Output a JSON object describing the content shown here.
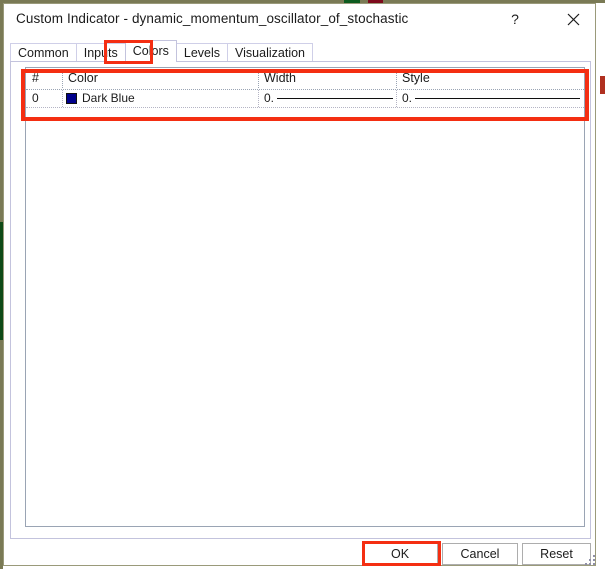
{
  "window": {
    "title": "Custom Indicator - dynamic_momentum_oscillator_of_stochastic",
    "help_label": "?",
    "close_label": "×"
  },
  "tabs": [
    {
      "label": "Common",
      "active": false
    },
    {
      "label": "Inputs",
      "active": false
    },
    {
      "label": "Colors",
      "active": true
    },
    {
      "label": "Levels",
      "active": false
    },
    {
      "label": "Visualization",
      "active": false
    }
  ],
  "colors_tab": {
    "columns": [
      "#",
      "Color",
      "Width",
      "Style"
    ],
    "rows": [
      {
        "index": "0",
        "color_name": "Dark Blue",
        "color_hex": "#00008b",
        "width": "0.",
        "style": "0."
      }
    ]
  },
  "footer": {
    "ok_label": "OK",
    "cancel_label": "Cancel",
    "reset_label": "Reset"
  },
  "highlights": {
    "accent_color": "#f42e12"
  }
}
